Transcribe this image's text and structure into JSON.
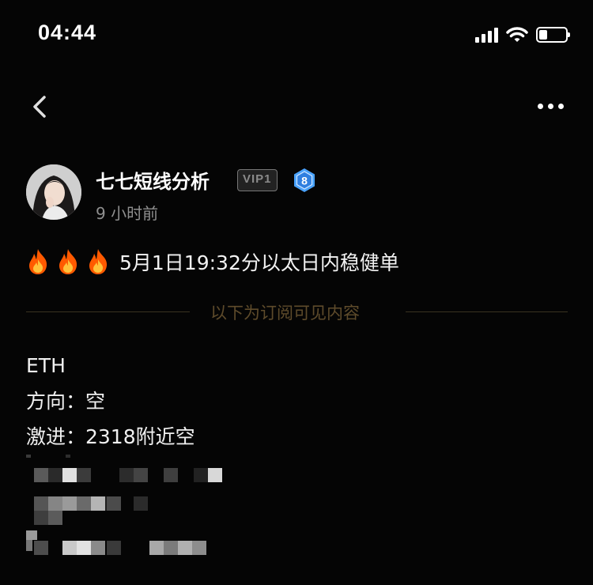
{
  "status_bar": {
    "time": "04:44"
  },
  "nav": {
    "back_icon": "chevron-left-icon",
    "more_icon": "more-dots-icon"
  },
  "author": {
    "name": "七七短线分析",
    "vip_badge": "VIP1",
    "level": "8",
    "posted": "9 小时前"
  },
  "post": {
    "headline": "5月1日19:32分以太日内稳健单",
    "divider_text": "以下为订阅可见内容",
    "lines": [
      "ETH",
      "方向：空",
      "激进：2318附近空"
    ]
  },
  "colors": {
    "background": "#050505",
    "divider_text": "#5e4b2b",
    "level_badge": "#4aa3ff",
    "fire": "#ff6a00"
  }
}
